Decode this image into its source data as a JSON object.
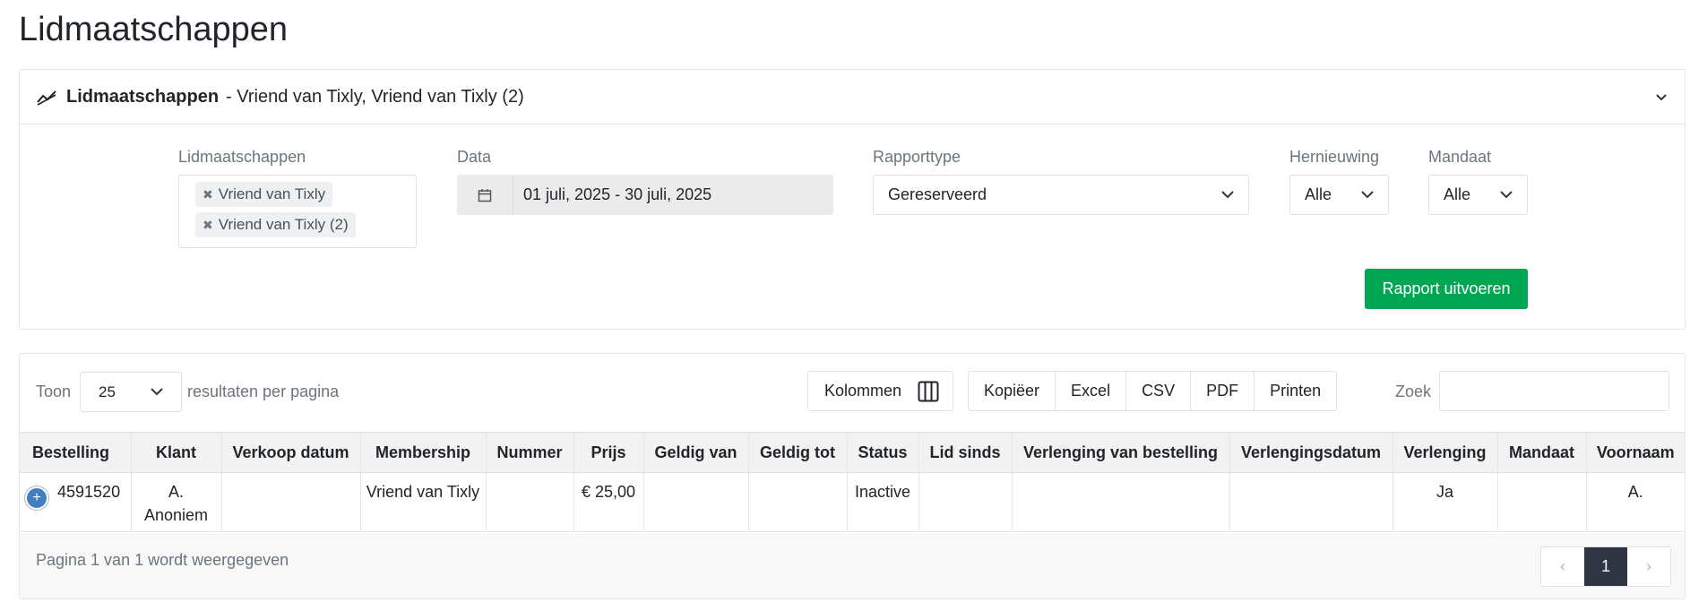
{
  "page_title": "Lidmaatschappen",
  "filter": {
    "header_title": "Lidmaatschappen",
    "header_subtitle": "- Vriend van Tixly, Vriend van Tixly (2)",
    "memberships_label": "Lidmaatschappen",
    "memberships_tags": [
      "Vriend van Tixly",
      "Vriend van Tixly (2)"
    ],
    "tag_remove_glyph": "✖",
    "date_label": "Data",
    "date_value": "01 juli, 2025 - 30 juli, 2025",
    "report_type_label": "Rapporttype",
    "report_type_value": "Gereserveerd",
    "renewal_label": "Hernieuwing",
    "renewal_value": "Alle",
    "mandate_label": "Mandaat",
    "mandate_value": "Alle",
    "run_button": "Rapport uitvoeren"
  },
  "results": {
    "show_label": "Toon",
    "page_size": "25",
    "per_page_label": "resultaten per pagina",
    "columns_button": "Kolommen",
    "export_buttons": [
      "Kopiëer",
      "Excel",
      "CSV",
      "PDF",
      "Printen"
    ],
    "search_label": "Zoek",
    "search_value": "",
    "columns": [
      "Bestelling",
      "Klant",
      "Verkoop datum",
      "Membership",
      "Nummer",
      "Prijs",
      "Geldig van",
      "Geldig tot",
      "Status",
      "Lid sinds",
      "Verlenging van bestelling",
      "Verlengingsdatum",
      "Verlenging",
      "Mandaat",
      "Voornaam"
    ],
    "rows": [
      [
        "4591520",
        "A. Anoniem",
        "",
        "Vriend van Tixly",
        "",
        "€ 25,00",
        "",
        "",
        "Inactive",
        "",
        "",
        "",
        "Ja",
        "",
        "A."
      ]
    ],
    "footer_text": "Pagina 1 van 1 wordt weergegeven",
    "pager_prev": "‹",
    "pager_current": "1",
    "pager_next": "›"
  },
  "colors": {
    "run_button": "#00a651",
    "pager_active": "#2f3540",
    "expand_button": "#3f7fbf"
  }
}
